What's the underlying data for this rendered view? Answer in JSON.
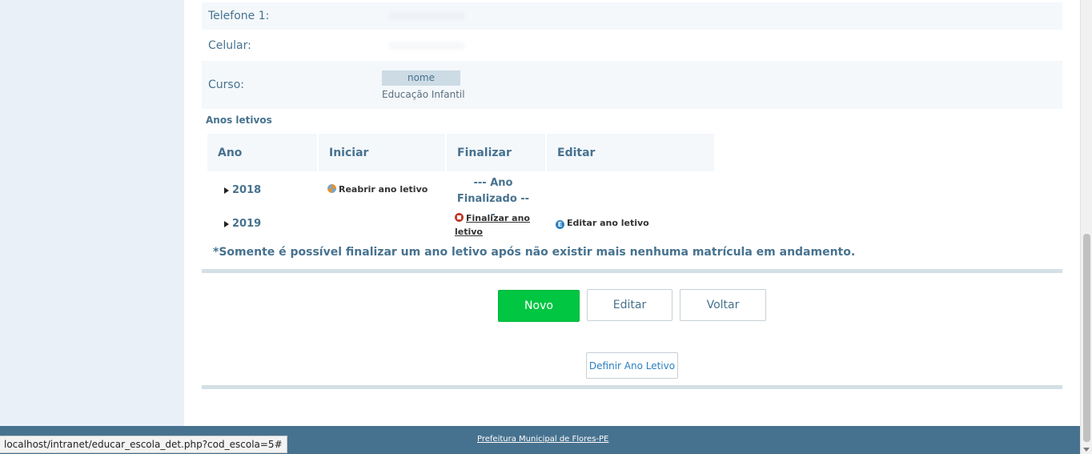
{
  "info": {
    "telefone_label": "Telefone 1:",
    "celular_label": "Celular:",
    "curso_label": "Curso:",
    "curso_header": "nome",
    "curso_value": "Educação Infantil"
  },
  "anos": {
    "title": "Anos letivos",
    "headers": [
      "Ano",
      "Iniciar",
      "Finalizar",
      "Editar"
    ],
    "rows": [
      {
        "ano": "2018",
        "iniciar": "Reabrir ano letivo",
        "finalizar": "--- Ano Finalizado ---",
        "editar": ""
      },
      {
        "ano": "2019",
        "iniciar": "",
        "finalizar": "Finalizar ano letivo",
        "editar": "Editar ano letivo"
      }
    ],
    "note": "*Somente é possível finalizar um ano letivo após não existir mais nenhuma matrícula em andamento."
  },
  "buttons": {
    "novo": "Novo",
    "editar": "Editar",
    "voltar": "Voltar",
    "definir": "Definir Ano Letivo"
  },
  "footer": {
    "link": "Prefeitura Municipal de Flores-PE"
  },
  "status_bar": {
    "url": "localhost/intranet/educar_escola_det.php?cod_escola=5#"
  },
  "colors": {
    "primary_text": "#47728f",
    "success": "#00c642",
    "footer_bg": "#47728f",
    "row_bg": "#f4f8fb"
  }
}
